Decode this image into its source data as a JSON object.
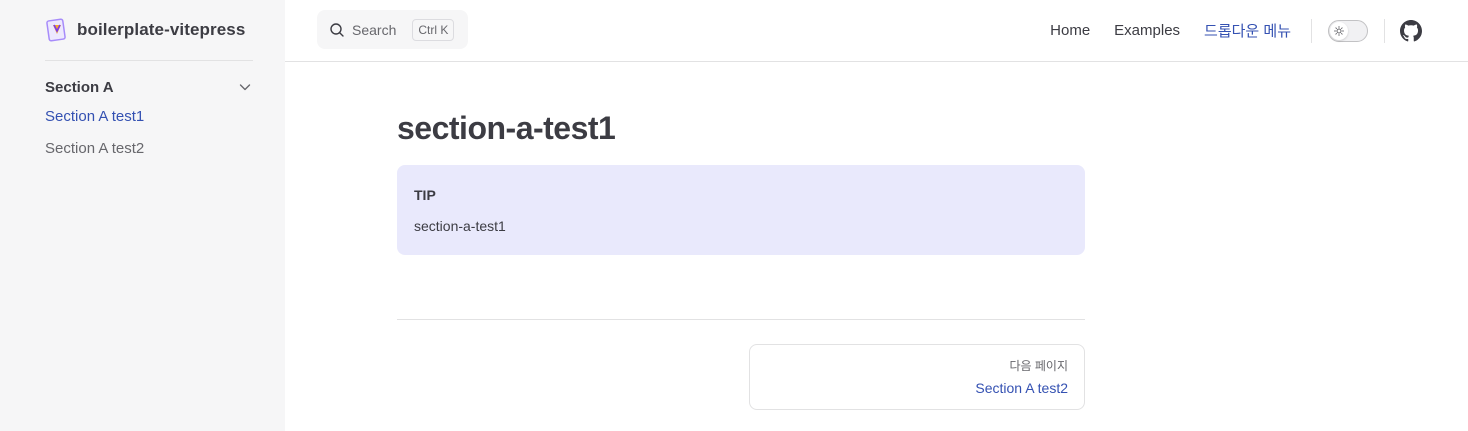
{
  "brand": {
    "title": "boilerplate-vitepress",
    "icon": "vitepress-logo-icon"
  },
  "sidebar": {
    "section": {
      "label": "Section A",
      "icon": "chevron-down-icon"
    },
    "items": [
      {
        "label": "Section A test1",
        "active": true
      },
      {
        "label": "Section A test2",
        "active": false
      }
    ]
  },
  "search": {
    "label": "Search",
    "shortcut": "Ctrl K",
    "icon": "search-icon"
  },
  "nav": {
    "links": [
      "Home",
      "Examples"
    ],
    "dropdown": "드롭다운 메뉴",
    "theme_toggle_icon": "sun-icon",
    "github_icon": "github-icon"
  },
  "main": {
    "title": "section-a-test1",
    "tip": {
      "title": "TIP",
      "text": "section-a-test1"
    },
    "next": {
      "desc": "다음 페이지",
      "title": "Section A test2"
    }
  },
  "colors": {
    "accent": "#3451b2",
    "tip_bg": "#e9e9fc",
    "sidebar_bg": "#f6f6f7"
  }
}
